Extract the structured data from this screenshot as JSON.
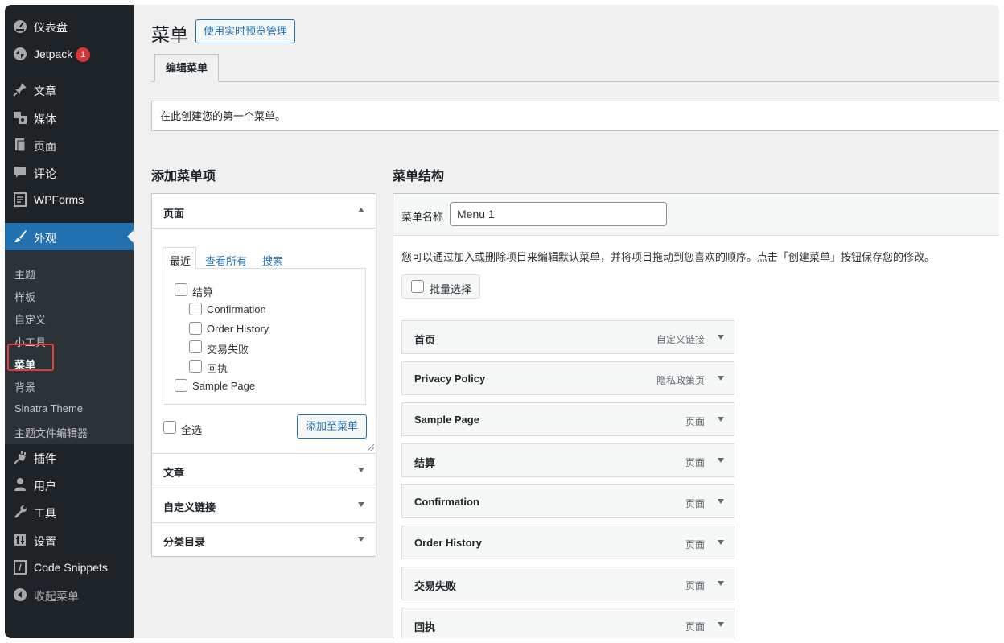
{
  "sidebar": {
    "items": [
      {
        "label": "仪表盘",
        "icon": "dashboard-icon"
      },
      {
        "label": "Jetpack",
        "icon": "jetpack-icon",
        "badge": "1"
      },
      {
        "label": "文章",
        "icon": "pin-icon"
      },
      {
        "label": "媒体",
        "icon": "media-icon"
      },
      {
        "label": "页面",
        "icon": "page-icon"
      },
      {
        "label": "评论",
        "icon": "comment-icon"
      },
      {
        "label": "WPForms",
        "icon": "wpforms-icon"
      },
      {
        "label": "外观",
        "icon": "brush-icon"
      },
      {
        "label": "插件",
        "icon": "plugin-icon"
      },
      {
        "label": "用户",
        "icon": "user-icon"
      },
      {
        "label": "工具",
        "icon": "wrench-icon"
      },
      {
        "label": "设置",
        "icon": "settings-icon"
      },
      {
        "label": "Code Snippets",
        "icon": "code-icon"
      },
      {
        "label": "收起菜单",
        "icon": "collapse-icon"
      }
    ],
    "submenu": [
      "主题",
      "样板",
      "自定义",
      "小工具",
      "菜单",
      "背景",
      "Sinatra Theme",
      "主题文件编辑器"
    ]
  },
  "header": {
    "title": "菜单",
    "preview_button": "使用实时预览管理",
    "tab_edit": "编辑菜单"
  },
  "notice": "在此创建您的第一个菜单。",
  "add_items": {
    "heading": "添加菜单项",
    "pages_panel": {
      "title": "页面",
      "tabs": [
        "最近",
        "查看所有",
        "搜索"
      ],
      "pages": [
        {
          "label": "结算",
          "indent": 0
        },
        {
          "label": "Confirmation",
          "indent": 1
        },
        {
          "label": "Order History",
          "indent": 1
        },
        {
          "label": "交易失败",
          "indent": 1
        },
        {
          "label": "回执",
          "indent": 1
        },
        {
          "label": "Sample Page",
          "indent": 0
        }
      ],
      "select_all": "全选",
      "add_button": "添加至菜单"
    },
    "other_panels": [
      "文章",
      "自定义链接",
      "分类目录"
    ]
  },
  "menu_structure": {
    "heading": "菜单结构",
    "name_label": "菜单名称",
    "name_value": "Menu 1",
    "description": "您可以通过加入或删除项目来编辑默认菜单，并将项目拖动到您喜欢的顺序。点击「创建菜单」按钮保存您的修改。",
    "bulk_select": "批量选择",
    "items": [
      {
        "name": "首页",
        "type": "自定义链接"
      },
      {
        "name": "Privacy Policy",
        "type": "隐私政策页"
      },
      {
        "name": "Sample Page",
        "type": "页面"
      },
      {
        "name": "结算",
        "type": "页面"
      },
      {
        "name": "Confirmation",
        "type": "页面"
      },
      {
        "name": "Order History",
        "type": "页面"
      },
      {
        "name": "交易失败",
        "type": "页面"
      },
      {
        "name": "回执",
        "type": "页面"
      }
    ]
  }
}
